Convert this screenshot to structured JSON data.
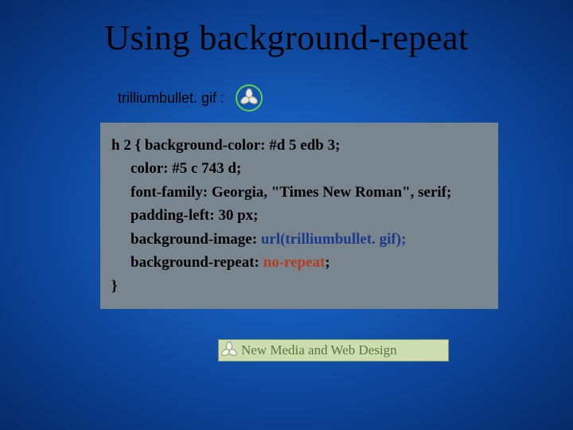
{
  "title": "Using background-repeat",
  "bullet_label": "trilliumbullet. gif :",
  "bullet_icon_name": "trillium-bullet-icon",
  "code": {
    "line1_prefix": "h 2 { ",
    "prop_bgcolor": "background-color: #d 5 edb 3;",
    "prop_color": "color: #5 c 743 d;",
    "prop_font": "font-family: Georgia, \"Times New Roman\", serif;",
    "prop_padding": "padding-left: 30 px;",
    "prop_bgimage_key": "background-image: ",
    "prop_bgimage_val": "url(trilliumbullet. gif);",
    "prop_bgrepeat_key": "background-repeat: ",
    "prop_bgrepeat_val": "no-repeat",
    "prop_bgrepeat_tail": ";",
    "close_brace": "}"
  },
  "footer": {
    "icon_name": "trillium-bullet-icon",
    "text": "New Media and Web Design"
  }
}
